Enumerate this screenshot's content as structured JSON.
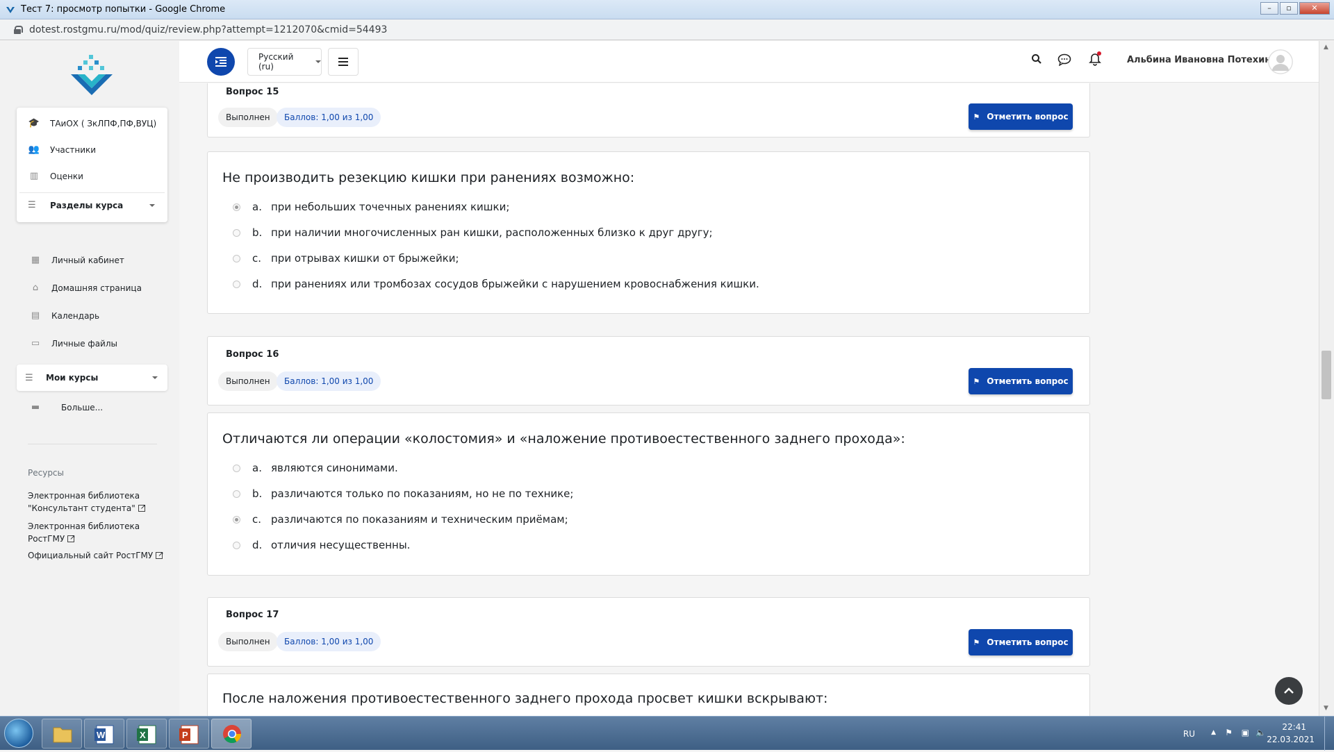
{
  "window": {
    "title": "Тест 7: просмотр попытки - Google Chrome",
    "url": "dotest.rostgmu.ru/mod/quiz/review.php?attempt=1212070&cmid=54493"
  },
  "sidebar": {
    "course_items": [
      {
        "label": "ТАиОХ ( ЗкЛПФ,ПФ,ВУЦ)",
        "icon": "graduation-cap-icon"
      },
      {
        "label": "Участники",
        "icon": "users-icon"
      },
      {
        "label": "Оценки",
        "icon": "book-icon"
      }
    ],
    "course_sections": "Разделы курса",
    "main_items": [
      {
        "label": "Личный кабинет",
        "icon": "dashboard-icon"
      },
      {
        "label": "Домашняя страница",
        "icon": "home-icon"
      },
      {
        "label": "Календарь",
        "icon": "calendar-icon"
      },
      {
        "label": "Личные файлы",
        "icon": "files-icon"
      }
    ],
    "my_courses": "Мои курсы",
    "more": "Больше...",
    "resources_title": "Ресурсы",
    "resources": [
      "Электронная библиотека \"Консультант студента\"",
      "Электронная библиотека РостГМУ",
      "Официальный сайт РостГМУ"
    ]
  },
  "topbar": {
    "language": "Русский (ru)",
    "user_name": "Альбина Ивановна Потехина"
  },
  "questions": [
    {
      "title": "Вопрос 15",
      "status": "Выполнен",
      "grade": "Баллов: 1,00 из 1,00",
      "flag_label": "Отметить вопрос",
      "text": "Не производить резекцию кишки при ранениях возможно:",
      "answers": [
        {
          "letter": "a.",
          "text": "при небольших точечных ранениях кишки;",
          "selected": true
        },
        {
          "letter": "b.",
          "text": "при наличии многочисленных ран кишки, расположенных близко к друг другу;",
          "selected": false
        },
        {
          "letter": "c.",
          "text": "при отрывах кишки от брыжейки;",
          "selected": false
        },
        {
          "letter": "d.",
          "text": "при ранениях или тромбозах сосудов брыжейки с нарушением кровоснабжения кишки.",
          "selected": false
        }
      ]
    },
    {
      "title": "Вопрос 16",
      "status": "Выполнен",
      "grade": "Баллов: 1,00 из 1,00",
      "flag_label": "Отметить вопрос",
      "text": "Отличаются ли операции «колостомия» и «наложение противоестественного заднего прохода»:",
      "answers": [
        {
          "letter": "a.",
          "text": "являются синонимами.",
          "selected": false
        },
        {
          "letter": "b.",
          "text": "различаются только по показаниям, но не по технике;",
          "selected": false
        },
        {
          "letter": "c.",
          "text": "различаются по показаниям и техническим приёмам;",
          "selected": true
        },
        {
          "letter": "d.",
          "text": "отличия несущественны.",
          "selected": false
        }
      ]
    },
    {
      "title": "Вопрос 17",
      "status": "Выполнен",
      "grade": "Баллов: 1,00 из 1,00",
      "flag_label": "Отметить вопрос",
      "text": "После наложения противоестественного заднего прохода просвет кишки вскрывают:"
    }
  ],
  "taskbar": {
    "lang": "RU",
    "time": "22:41",
    "date": "22.03.2021"
  },
  "colors": {
    "primary": "#0f47ad",
    "grade_tag_bg": "#e9effb"
  }
}
